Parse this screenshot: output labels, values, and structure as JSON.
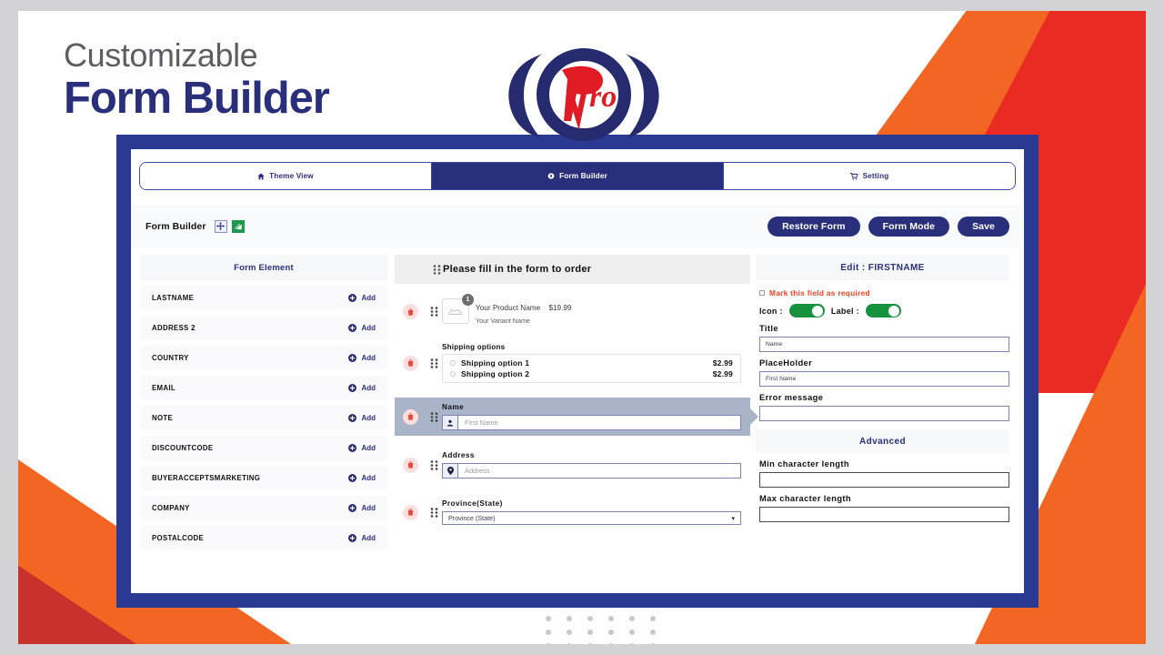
{
  "header": {
    "subtitle": "Customizable",
    "title": "Form Builder",
    "logo_text": "Pro"
  },
  "tabs": [
    {
      "label": "Theme View",
      "icon": "home-icon",
      "active": false
    },
    {
      "label": "Form Builder",
      "icon": "gear-icon",
      "active": true
    },
    {
      "label": "Setting",
      "icon": "cart-icon",
      "active": false
    }
  ],
  "toolbar": {
    "title": "Form Builder",
    "restore_label": "Restore Form",
    "mode_label": "Form Mode",
    "save_label": "Save"
  },
  "left_panel": {
    "heading": "Form Element",
    "add_label": "Add",
    "items": [
      "LASTNAME",
      "ADDRESS 2",
      "COUNTRY",
      "EMAIL",
      "NOTE",
      "DISCOUNTCODE",
      "BUYERACCEPTSMARKETING",
      "COMPANY",
      "POSTALCODE"
    ]
  },
  "center_panel": {
    "heading": "Please fill in the form to order",
    "product": {
      "badge": "1",
      "name": "Your Product Name",
      "price": "$19.99",
      "variant": "Your Variant Name"
    },
    "shipping": {
      "title": "Shipping options",
      "options": [
        {
          "label": "Shipping option 1",
          "price": "$2.99"
        },
        {
          "label": "Shipping option 2",
          "price": "$2.99"
        }
      ]
    },
    "fields": [
      {
        "label": "Name",
        "placeholder": "First Name",
        "icon": "user-icon",
        "selected": true
      },
      {
        "label": "Address",
        "placeholder": "Address",
        "icon": "pin-icon",
        "selected": false
      }
    ],
    "province": {
      "label": "Province(State)",
      "value": "Province (State)"
    }
  },
  "right_panel": {
    "heading": "Edit : FIRSTNAME",
    "required_label": "Mark this field as required",
    "icon_toggle_label": "Icon :",
    "label_toggle_label": "Label :",
    "title_label": "Title",
    "title_value": "Name",
    "placeholder_label": "PlaceHolder",
    "placeholder_value": "First Name",
    "error_label": "Error message",
    "error_value": "",
    "advanced_heading": "Advanced",
    "min_label": "Min character length",
    "min_value": "",
    "max_label": "Max character length",
    "max_value": ""
  },
  "colors": {
    "navy": "#2a2f7c",
    "frame_blue": "#2a3a92",
    "orange": "#f26522",
    "red": "#ea2b24",
    "green": "#16923f",
    "required_red": "#f04123"
  }
}
